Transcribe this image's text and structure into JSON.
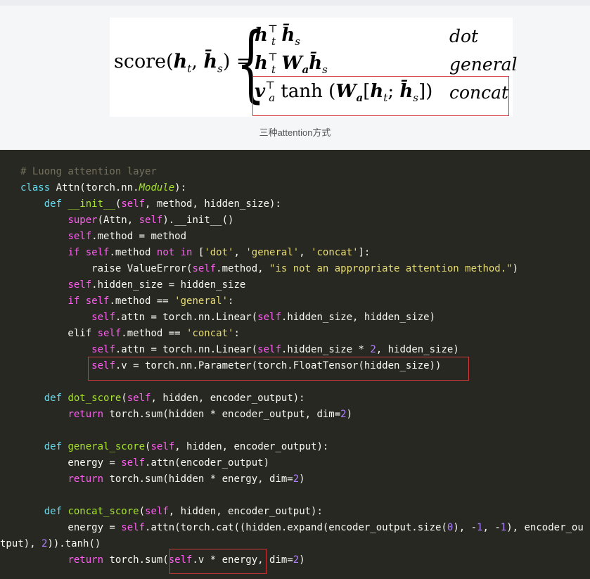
{
  "formula": {
    "lhs": "score(",
    "lhs_args": "h_t, h̄_s",
    "lhs_close": ") =",
    "cases": [
      {
        "expr": "h_t^⊤ h̄_s",
        "label": "dot"
      },
      {
        "expr": "h_t^⊤ W_a h̄_s",
        "label": "general"
      },
      {
        "expr": "v_a^⊤ tanh (W_a[h_t; h̄_s])",
        "label": "concat"
      }
    ]
  },
  "caption": "三种attention方式",
  "code_lines": [
    "# Luong attention layer",
    "class Attn(torch.nn.Module):",
    "    def __init__(self, method, hidden_size):",
    "        super(Attn, self).__init__()",
    "        self.method = method",
    "        if self.method not in ['dot', 'general', 'concat']:",
    "            raise ValueError(self.method, \"is not an appropriate attention method.\")",
    "        self.hidden_size = hidden_size",
    "        if self.method == 'general':",
    "            self.attn = torch.nn.Linear(self.hidden_size, hidden_size)",
    "        elif self.method == 'concat':",
    "            self.attn = torch.nn.Linear(self.hidden_size * 2, hidden_size)",
    "            self.v = torch.nn.Parameter(torch.FloatTensor(hidden_size))",
    "",
    "    def dot_score(self, hidden, encoder_output):",
    "        return torch.sum(hidden * encoder_output, dim=2)",
    "",
    "    def general_score(self, hidden, encoder_output):",
    "        energy = self.attn(encoder_output)",
    "        return torch.sum(hidden * energy, dim=2)",
    "",
    "    def concat_score(self, hidden, encoder_output):",
    "        energy = self.attn(torch.cat((hidden.expand(encoder_output.size(0), -1, -1), encoder_ou",
    "tput), 2)).tanh()",
    "        return torch.sum(self.v * energy, dim=2)"
  ]
}
